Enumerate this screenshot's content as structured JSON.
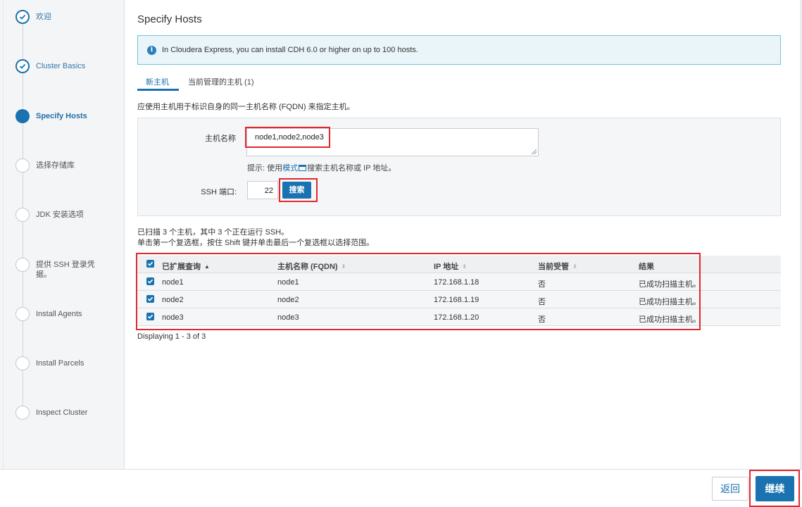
{
  "sidebar": {
    "steps": [
      {
        "label": "欢迎",
        "state": "done"
      },
      {
        "label": "Cluster Basics",
        "state": "done"
      },
      {
        "label": "Specify Hosts",
        "state": "active"
      },
      {
        "label": "选择存储库",
        "state": "pending"
      },
      {
        "label": "JDK 安装选项",
        "state": "pending"
      },
      {
        "label": "提供 SSH 登录凭据。",
        "state": "pending"
      },
      {
        "label": "Install Agents",
        "state": "pending"
      },
      {
        "label": "Install Parcels",
        "state": "pending"
      },
      {
        "label": "Inspect Cluster",
        "state": "pending"
      }
    ]
  },
  "page": {
    "title": "Specify Hosts",
    "info": "In Cloudera Express, you can install CDH 6.0 or higher on up to 100 hosts.",
    "tabs": [
      "新主机",
      "当前管理的主机 (1)"
    ],
    "instruction": "应使用主机用于标识自身的同一主机名称 (FQDN) 来指定主机。"
  },
  "form": {
    "hostname_label": "主机名称",
    "hostname_value": "node1,node2,node3",
    "hint_prefix": "提示: 使用",
    "hint_link": "模式",
    "hint_suffix": "搜索主机名称或 IP 地址。",
    "ssh_label": "SSH 端口:",
    "ssh_port": "22",
    "search_label": "搜索"
  },
  "scan": {
    "line1": "已扫描 3 个主机，其中 3 个正在运行 SSH。",
    "line2": "单击第一个复选框，按住 Shift 键并单击最后一个复选框以选择范围。"
  },
  "table": {
    "headers": [
      "已扩展查询",
      "主机名称 (FQDN)",
      "IP 地址",
      "当前受管",
      "结果"
    ],
    "rows": [
      [
        "node1",
        "node1",
        "172.168.1.18",
        "否",
        "已成功扫描主机。"
      ],
      [
        "node2",
        "node2",
        "172.168.1.19",
        "否",
        "已成功扫描主机。"
      ],
      [
        "node3",
        "node3",
        "172.168.1.20",
        "否",
        "已成功扫描主机。"
      ]
    ],
    "footer": "Displaying 1 - 3 of 3"
  },
  "actions": {
    "back": "返回",
    "continue": "继续"
  },
  "colors": {
    "accent": "#1a72b0",
    "highlight": "#e0282e"
  }
}
